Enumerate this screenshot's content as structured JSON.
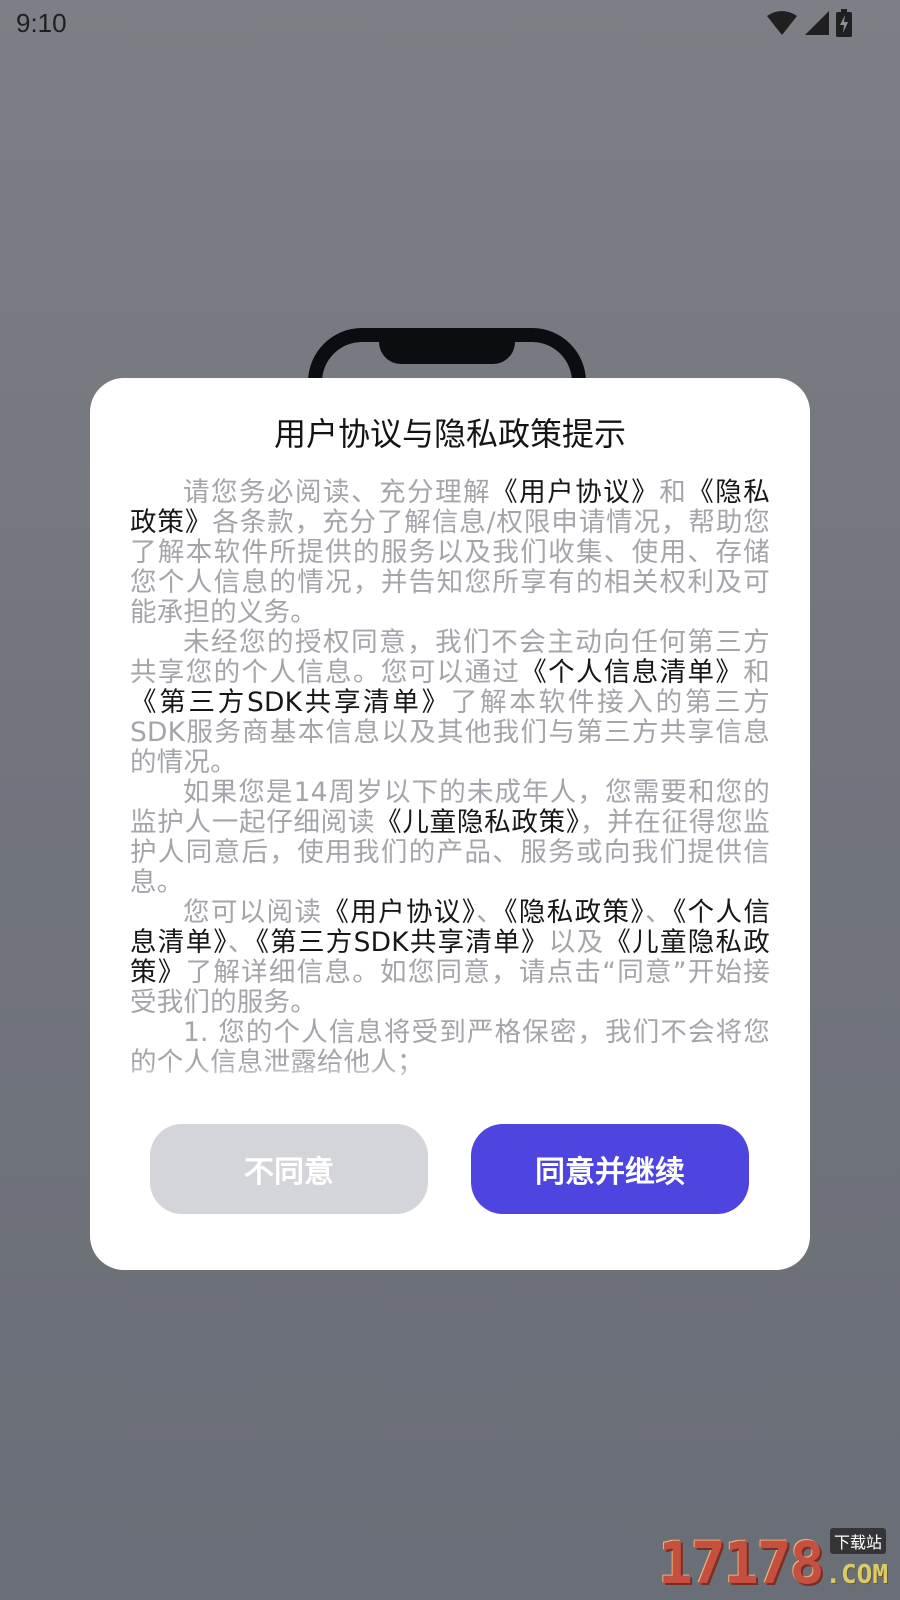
{
  "status_bar": {
    "time": "9:10",
    "icons": [
      "wifi-icon",
      "cellular-signal-icon",
      "battery-charging-icon"
    ]
  },
  "dialog": {
    "title": "用户协议与隐私政策提示",
    "paragraphs": [
      [
        {
          "text": "请您务必阅读、充分理解",
          "link": false
        },
        {
          "text": "《用户协议》",
          "link": true
        },
        {
          "text": "和",
          "link": false
        },
        {
          "text": "《隐私政策》",
          "link": true
        },
        {
          "text": "各条款，充分了解信息/权限申请情况，帮助您了解本软件所提供的服务以及我们收集、使用、存储您个人信息的情况，并告知您所享有的相关权利及可能承担的义务。",
          "link": false
        }
      ],
      [
        {
          "text": "未经您的授权同意，我们不会主动向任何第三方共享您的个人信息。您可以通过",
          "link": false
        },
        {
          "text": "《个人信息清单》",
          "link": true
        },
        {
          "text": "和",
          "link": false
        },
        {
          "text": "《第三方SDK共享清单》",
          "link": true
        },
        {
          "text": "了解本软件接入的第三方SDK服务商基本信息以及其他我们与第三方共享信息的情况。",
          "link": false
        }
      ],
      [
        {
          "text": "如果您是14周岁以下的未成年人，您需要和您的监护人一起仔细阅读",
          "link": false
        },
        {
          "text": "《儿童隐私政策》",
          "link": true
        },
        {
          "text": "，并在征得您监护人同意后，使用我们的产品、服务或向我们提供信息。",
          "link": false
        }
      ],
      [
        {
          "text": "您可以阅读",
          "link": false
        },
        {
          "text": "《用户协议》",
          "link": true
        },
        {
          "text": "、",
          "link": false
        },
        {
          "text": "《隐私政策》",
          "link": true
        },
        {
          "text": "、",
          "link": false
        },
        {
          "text": "《个人信息清单》",
          "link": true
        },
        {
          "text": "、",
          "link": false
        },
        {
          "text": "《第三方SDK共享清单》",
          "link": true
        },
        {
          "text": "以及",
          "link": false
        },
        {
          "text": "《儿童隐私政策》",
          "link": true
        },
        {
          "text": "了解详细信息。如您同意，请点击“同意”开始接受我们的服务。",
          "link": false
        }
      ],
      [
        {
          "text": "1. 您的个人信息将受到严格保密，我们不会将您的个人信息泄露给他人；",
          "link": false
        }
      ]
    ],
    "disagree_label": "不同意",
    "agree_label": "同意并继续",
    "accent_color": "#4e44e0",
    "disabled_color": "#d3d5da"
  },
  "watermark": {
    "number": "17178",
    "suffix": ".COM",
    "label": "下载站"
  }
}
